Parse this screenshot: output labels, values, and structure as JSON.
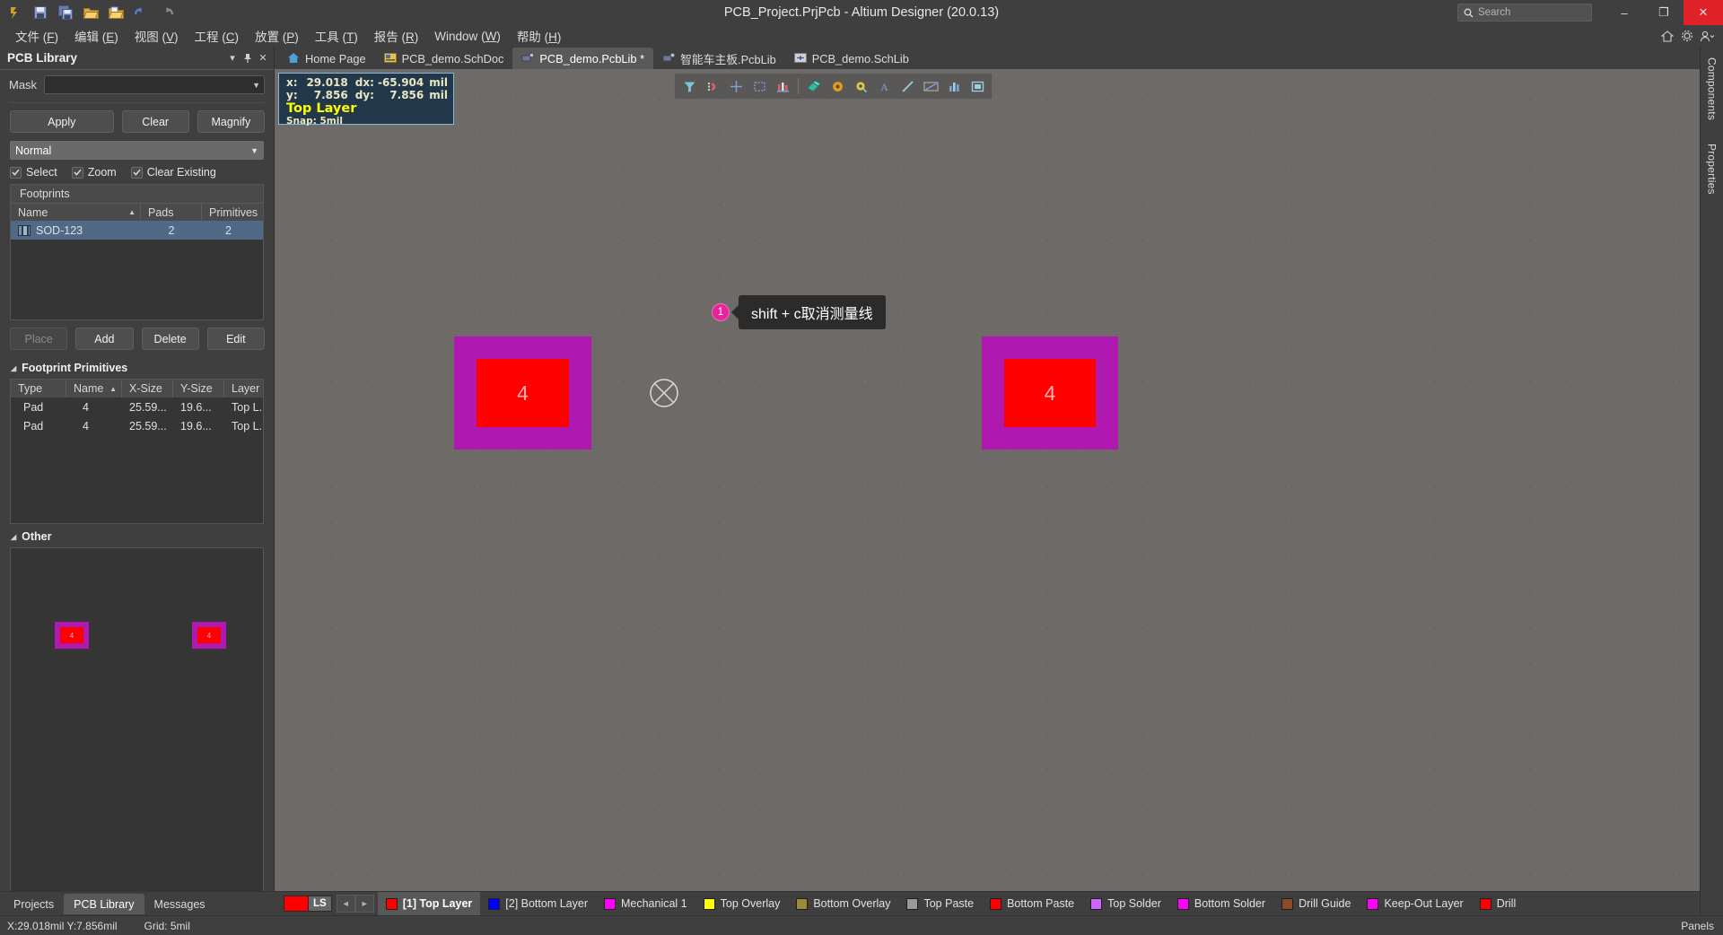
{
  "window": {
    "title": "PCB_Project.PrjPcb - Altium Designer (20.0.13)",
    "search_placeholder": "Search",
    "minimize": "–",
    "maximize": "❐",
    "close": "✕"
  },
  "toolbar_icons": [
    {
      "name": "altium-logo-icon"
    },
    {
      "name": "save-icon"
    },
    {
      "name": "save-all-icon"
    },
    {
      "name": "open-folder-icon"
    },
    {
      "name": "open-project-icon"
    },
    {
      "name": "undo-icon"
    },
    {
      "name": "redo-icon"
    }
  ],
  "menu": {
    "items": [
      {
        "label": "文件",
        "key": "F"
      },
      {
        "label": "编辑",
        "key": "E"
      },
      {
        "label": "视图",
        "key": "V"
      },
      {
        "label": "工程",
        "key": "C"
      },
      {
        "label": "放置",
        "key": "P"
      },
      {
        "label": "工具",
        "key": "T"
      },
      {
        "label": "报告",
        "key": "R"
      },
      {
        "label": "Window",
        "key": "W"
      },
      {
        "label": "帮助",
        "key": "H"
      }
    ],
    "right_icons": [
      "home-icon",
      "gear-icon",
      "user-icon"
    ]
  },
  "pcb_library": {
    "title": "PCB Library",
    "header_buttons": [
      "chevron-down-icon",
      "pin-icon",
      "close-icon"
    ],
    "mask": {
      "label": "Mask",
      "value": "",
      "placeholder": ""
    },
    "buttons": {
      "apply": "Apply",
      "clear": "Clear",
      "magnify": "Magnify"
    },
    "mode": "Normal",
    "checkboxes": [
      {
        "label": "Select",
        "checked": true
      },
      {
        "label": "Zoom",
        "checked": true
      },
      {
        "label": "Clear Existing",
        "checked": true
      }
    ],
    "footprints": {
      "group_title": "Footprints",
      "columns": [
        "Name",
        "Pads",
        "Primitives"
      ],
      "rows": [
        {
          "name": "SOD-123",
          "pads": "2",
          "primitives": "2",
          "selected": true
        }
      ]
    },
    "action_buttons": [
      {
        "label": "Place",
        "disabled": true
      },
      {
        "label": "Add",
        "disabled": false
      },
      {
        "label": "Delete",
        "disabled": false
      },
      {
        "label": "Edit",
        "disabled": false
      }
    ],
    "primitives": {
      "section_title": "Footprint Primitives",
      "columns": [
        "Type",
        "Name",
        "X-Size",
        "Y-Size",
        "Layer"
      ],
      "rows": [
        {
          "type": "Pad",
          "name": "4",
          "xsize": "25.59...",
          "ysize": "19.6...",
          "layer": "Top L..."
        },
        {
          "type": "Pad",
          "name": "4",
          "xsize": "25.59...",
          "ysize": "19.6...",
          "layer": "Top L..."
        }
      ]
    },
    "other": {
      "section_title": "Other",
      "preview_pads": [
        {
          "label": "4"
        },
        {
          "label": "4"
        }
      ]
    }
  },
  "document_tabs": [
    {
      "label": "Home Page",
      "icon": "home-icon",
      "active": false
    },
    {
      "label": "PCB_demo.SchDoc",
      "icon": "sheet-icon",
      "active": false
    },
    {
      "label": "PCB_demo.PcbLib *",
      "icon": "pcblib-icon",
      "active": true
    },
    {
      "label": "智能车主板.PcbLib",
      "icon": "pcblib-icon",
      "active": false
    },
    {
      "label": "PCB_demo.SchLib",
      "icon": "schlib-icon",
      "active": false
    }
  ],
  "coordinates": {
    "x_label": "x:",
    "x_value": "29.018",
    "dx_label": "dx:",
    "dx_value": "-65.904",
    "dx_unit": "mil",
    "y_label": "y:",
    "y_value": "7.856",
    "dy_label": "dy:",
    "dy_value": "7.856",
    "dy_unit": "mil",
    "layer": "Top Layer",
    "snap": "Snap: 5mil"
  },
  "canvas_toolbar": [
    {
      "name": "filter-icon"
    },
    {
      "name": "magnet-snap-icon"
    },
    {
      "name": "crosshair-icon"
    },
    {
      "name": "select-area-icon"
    },
    {
      "name": "measure-icon"
    },
    {
      "name": "eraser-icon"
    },
    {
      "name": "hole-icon"
    },
    {
      "name": "pad-icon"
    },
    {
      "name": "text-icon"
    },
    {
      "name": "line-icon"
    },
    {
      "name": "dimension-icon"
    },
    {
      "name": "chart-icon"
    },
    {
      "name": "frame-icon"
    }
  ],
  "canvas": {
    "pads": [
      {
        "label": "4"
      },
      {
        "label": "4"
      }
    ],
    "origin_marker": "origin-cross-icon"
  },
  "annotation": {
    "number": "1",
    "text": "shift + c取消测量线"
  },
  "panel_tabs": [
    {
      "label": "Projects",
      "active": false
    },
    {
      "label": "PCB Library",
      "active": true
    },
    {
      "label": "Messages",
      "active": false
    }
  ],
  "layer_selector": {
    "swatch_color": "#ff0000",
    "label": "LS",
    "prev": "◄",
    "next": "►"
  },
  "layer_tabs": [
    {
      "label": "[1] Top Layer",
      "color": "#ff0000",
      "active": true
    },
    {
      "label": "[2] Bottom Layer",
      "color": "#0000ff",
      "active": false
    },
    {
      "label": "Mechanical 1",
      "color": "#ff00ff",
      "active": false
    },
    {
      "label": "Top Overlay",
      "color": "#ffff00",
      "active": false
    },
    {
      "label": "Bottom Overlay",
      "color": "#9b8a3a",
      "active": false
    },
    {
      "label": "Top Paste",
      "color": "#999999",
      "active": false
    },
    {
      "label": "Bottom Paste",
      "color": "#ff0000",
      "active": false
    },
    {
      "label": "Top Solder",
      "color": "#cc66ff",
      "active": false
    },
    {
      "label": "Bottom Solder",
      "color": "#ff00ff",
      "active": false
    },
    {
      "label": "Drill Guide",
      "color": "#8b4a2a",
      "active": false
    },
    {
      "label": "Keep-Out Layer",
      "color": "#ff00ff",
      "active": false
    },
    {
      "label": "Drill",
      "color": "#ff0000",
      "active": false
    }
  ],
  "status": {
    "coordinates": "X:29.018mil Y:7.856mil",
    "grid": "Grid: 5mil",
    "panels": "Panels"
  },
  "right_dock": [
    {
      "label": "Components"
    },
    {
      "label": "Properties"
    }
  ]
}
